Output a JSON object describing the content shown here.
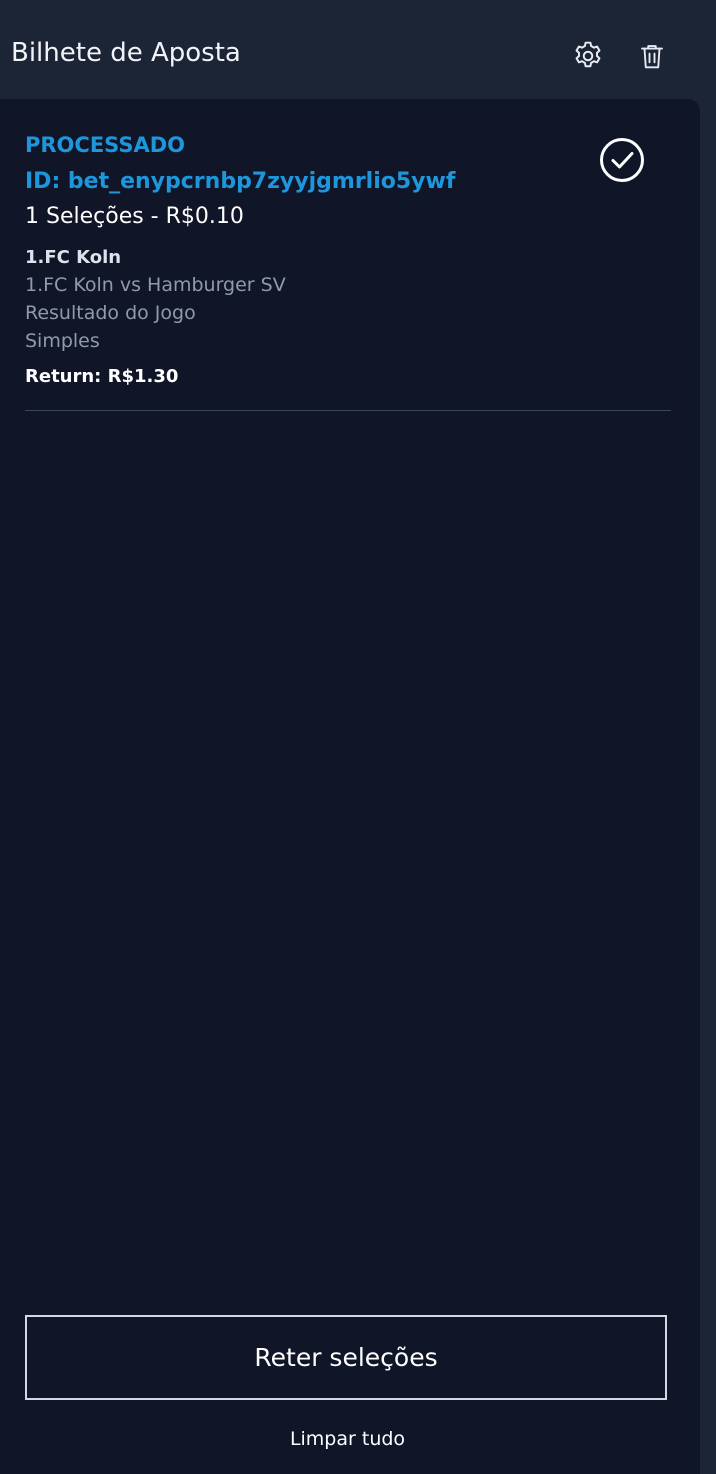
{
  "header": {
    "title": "Bilhete de Aposta",
    "settings_icon": "gear-icon",
    "delete_icon": "trash-icon"
  },
  "bet": {
    "status": "PROCESSADO",
    "id": "ID: bet_enypcrnbp7zyyjgmrlio5ywf",
    "summary": "1 Seleções - R$0.10",
    "status_icon": "check-circle-icon",
    "selection": {
      "team": "1.FC Koln",
      "match": "1.FC Koln vs Hamburger SV",
      "market": "Resultado do Jogo",
      "type": "Simples"
    },
    "return": "Return: R$1.30"
  },
  "actions": {
    "retain_label": "Reter seleções",
    "clear_label": "Limpar tudo"
  },
  "colors": {
    "header_bg": "#1c2536",
    "panel_bg": "#101628",
    "accent": "#1e96dc"
  }
}
